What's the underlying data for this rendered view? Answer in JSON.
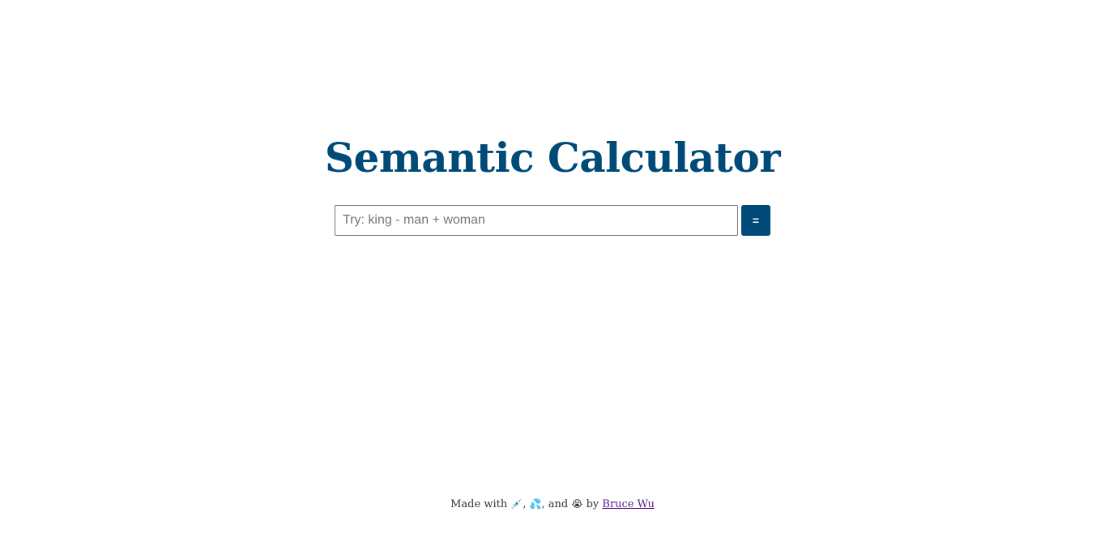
{
  "page": {
    "title": "Semantic Calculator"
  },
  "calculator": {
    "placeholder": "Try: king - man + woman",
    "value": "",
    "equals_label": "="
  },
  "footer": {
    "prefix": "Made with",
    "emoji_1": "💉",
    "sep_1": ",",
    "emoji_2": "💦",
    "sep_2": ", and",
    "emoji_3": "😭",
    "by": "by",
    "author_link": "Bruce Wu"
  },
  "colors": {
    "brand": "#004a77",
    "link_visited": "#551a8b"
  }
}
